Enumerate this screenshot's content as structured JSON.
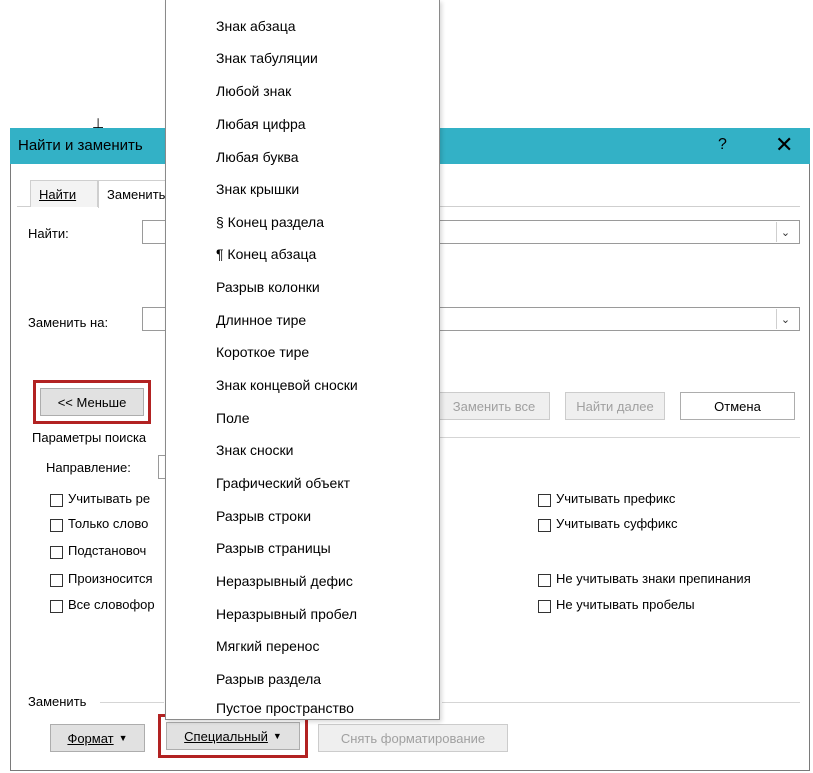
{
  "dialog": {
    "title": "Найти и заменить",
    "help": "?",
    "close": "✕",
    "tabs": [
      {
        "label": "Найти"
      },
      {
        "label": "Заменить"
      }
    ],
    "find_label": "Найти:",
    "replace_label": "Заменить на:",
    "less_button": "<< Меньше",
    "replace_all_button": "Заменить все",
    "find_next_button": "Найти далее",
    "cancel_button": "Отмена",
    "search_options_label": "Параметры поиска",
    "direction_label": "Направление:",
    "checkboxes_left": [
      {
        "label": "Учитывать ре",
        "checked": false
      },
      {
        "label": "Только слово",
        "checked": false
      },
      {
        "label": "Подстановоч",
        "checked": false
      },
      {
        "label": "Произносится",
        "checked": false
      },
      {
        "label": "Все словофор",
        "checked": false
      }
    ],
    "checkboxes_right": [
      {
        "label": "Учитывать префикс",
        "checked": false
      },
      {
        "label": "Учитывать суффикс",
        "checked": false
      },
      {
        "label": "Не учитывать знаки препинания",
        "checked": false
      },
      {
        "label": "Не учитывать пробелы",
        "checked": false
      }
    ],
    "replace_group_label": "Заменить",
    "format_button": "Формат",
    "special_button": "Специальный",
    "clear_format_button": "Снять форматирование"
  },
  "special_menu": {
    "items": [
      "Знак абзаца",
      "Знак табуляции",
      "Любой знак",
      "Любая цифра",
      "Любая буква",
      "Знак крышки",
      "§ Конец раздела",
      "¶ Конец абзаца",
      "Разрыв колонки",
      "Длинное тире",
      "Короткое тире",
      "Знак концевой сноски",
      "Поле",
      "Знак сноски",
      "Графический объект",
      "Разрыв строки",
      "Разрыв страницы",
      "Неразрывный дефис",
      "Неразрывный пробел",
      "Мягкий перенос",
      "Разрыв раздела",
      "Пустое пространство"
    ]
  },
  "colors": {
    "titlebar": "#33b1c6",
    "highlight": "#b22222"
  }
}
